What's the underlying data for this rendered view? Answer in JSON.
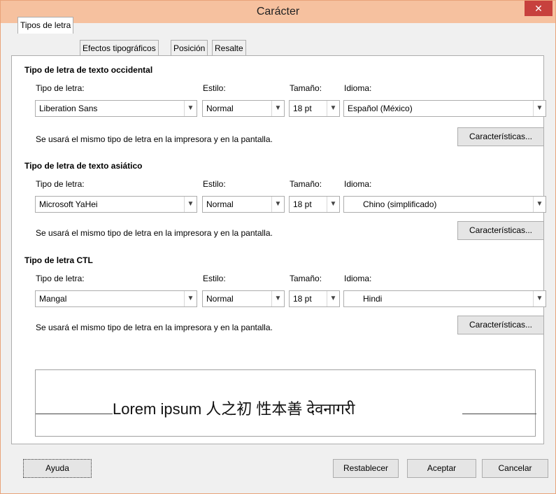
{
  "window": {
    "title": "Carácter"
  },
  "tabs": [
    "Tipos de letra",
    "Efectos tipográficos",
    "Posición",
    "Resalte"
  ],
  "sections": [
    {
      "heading": "Tipo de letra de texto occidental",
      "font_label": "Tipo de letra:",
      "style_label": "Estilo:",
      "size_label": "Tamaño:",
      "lang_label": "Idioma:",
      "font_value": "Liberation Sans",
      "style_value": "Normal",
      "size_value": "18 pt",
      "lang_value": "Español (México)",
      "note": "Se usará el mismo tipo de letra en la impresora y en la pantalla.",
      "features_button": "Características..."
    },
    {
      "heading": "Tipo de letra de texto asiático",
      "font_label": "Tipo de letra:",
      "style_label": "Estilo:",
      "size_label": "Tamaño:",
      "lang_label": "Idioma:",
      "font_value": "Microsoft YaHei",
      "style_value": "Normal",
      "size_value": "18 pt",
      "lang_value": "Chino (simplificado)",
      "note": "Se usará el mismo tipo de letra en la impresora y en la pantalla.",
      "features_button": "Características..."
    },
    {
      "heading": "Tipo de letra CTL",
      "font_label": "Tipo de letra:",
      "style_label": "Estilo:",
      "size_label": "Tamaño:",
      "lang_label": "Idioma:",
      "font_value": "Mangal",
      "style_value": "Normal",
      "size_value": "18 pt",
      "lang_value": "Hindi",
      "note": "Se usará el mismo tipo de letra en la impresora y en la pantalla.",
      "features_button": "Características..."
    }
  ],
  "preview": {
    "text": "Lorem ipsum   人之初 性本善   देवनागरी"
  },
  "buttons": {
    "help": "Ayuda",
    "reset": "Restablecer",
    "ok": "Aceptar",
    "cancel": "Cancelar"
  }
}
